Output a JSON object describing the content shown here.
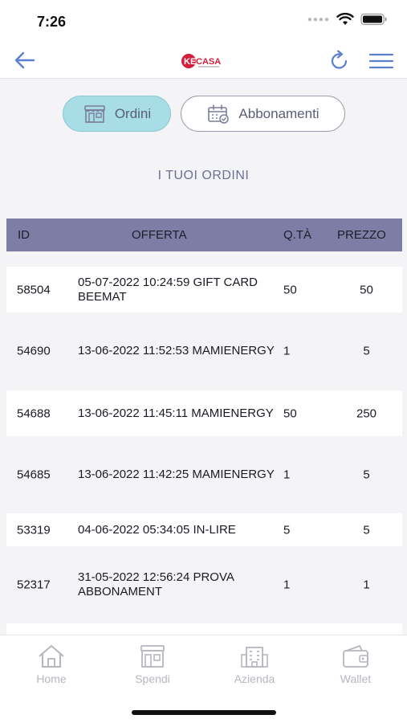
{
  "status": {
    "time": "7:26"
  },
  "segments": {
    "ordini": "Ordini",
    "abbonamenti": "Abbonamenti"
  },
  "section_title": "I TUOI ORDINI",
  "table": {
    "headers": {
      "id": "ID",
      "offerta": "OFFERTA",
      "qta": "Q.TÀ",
      "prezzo": "PREZZO"
    },
    "rows": [
      {
        "id": "58504",
        "offerta": "05-07-2022 10:24:59 GIFT CARD BEEMAT",
        "qta": "50",
        "prezzo": "50"
      },
      {
        "id": "54690",
        "offerta": "13-06-2022 11:52:53 MAMIENERGY",
        "qta": "1",
        "prezzo": "5"
      },
      {
        "id": "54688",
        "offerta": "13-06-2022 11:45:11 MAMIENERGY",
        "qta": "50",
        "prezzo": "250"
      },
      {
        "id": "54685",
        "offerta": "13-06-2022 11:42:25 MAMIENERGY",
        "qta": "1",
        "prezzo": "5"
      },
      {
        "id": "53319",
        "offerta": "04-06-2022 05:34:05 IN-LIRE",
        "qta": "5",
        "prezzo": "5"
      },
      {
        "id": "52317",
        "offerta": "31-05-2022 12:56:24 PROVA ABBONAMENT",
        "qta": "1",
        "prezzo": "1"
      }
    ]
  },
  "tabs": {
    "home": "Home",
    "spendi": "Spendi",
    "azienda": "Azienda",
    "wallet": "Wallet"
  },
  "colors": {
    "header_bg": "#7c7ea5",
    "active_segment": "#a9dde6",
    "accent": "#5b7fd1",
    "logo_red": "#d21f3c"
  }
}
